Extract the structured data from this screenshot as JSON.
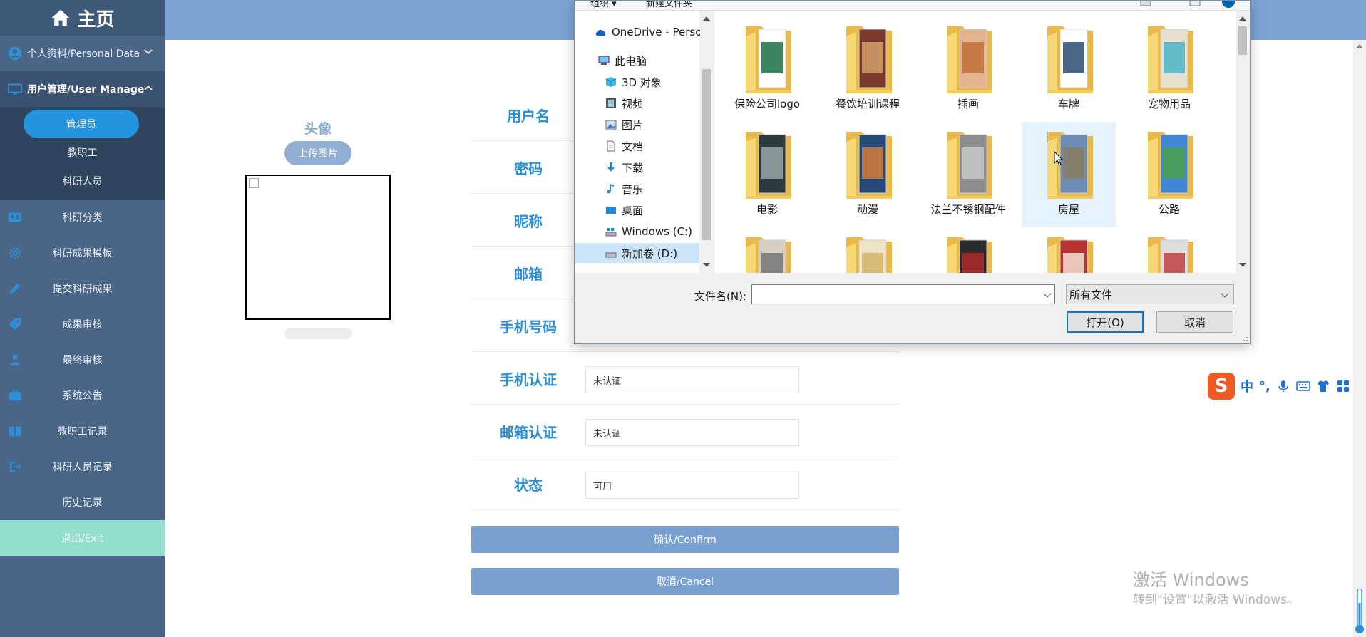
{
  "sidebar": {
    "home_label": "主页",
    "personal": "个人资料/Personal Data",
    "user_manage": "用户管理/User Manage",
    "sub_items": [
      "管理员",
      "教职工",
      "科研人员"
    ],
    "items": [
      "科研分类",
      "科研成果模板",
      "提交科研成果",
      "成果审核",
      "最终审核",
      "系统公告",
      "教职工记录",
      "科研人员记录",
      "历史记录"
    ],
    "exit": "退出/Exit"
  },
  "avatar": {
    "title": "头像",
    "upload": "上传图片"
  },
  "form": {
    "labels": [
      "用户名",
      "密码",
      "昵称",
      "邮箱",
      "手机号码",
      "手机认证",
      "邮箱认证",
      "状态"
    ],
    "values": [
      "",
      "",
      "",
      "",
      "",
      "未认证",
      "未认证",
      "可用"
    ],
    "confirm": "确认/Confirm",
    "cancel": "取消/Cancel"
  },
  "watermark": {
    "line1": "激活 Windows",
    "line2": "转到\"设置\"以激活 Windows。"
  },
  "ime": {
    "zh": "中",
    "punct": "°,"
  },
  "dialog": {
    "top_organize": "组织 ▾",
    "top_newfolder": "新建文件夹",
    "nav": [
      {
        "label": "OneDrive - Perso",
        "icon": "cloud-icon"
      },
      {
        "label": "此电脑",
        "icon": "computer-icon"
      },
      {
        "label": "3D 对象",
        "icon": "cube-icon"
      },
      {
        "label": "视频",
        "icon": "video-icon"
      },
      {
        "label": "图片",
        "icon": "picture-icon"
      },
      {
        "label": "文档",
        "icon": "document-icon"
      },
      {
        "label": "下载",
        "icon": "download-icon"
      },
      {
        "label": "音乐",
        "icon": "music-icon"
      },
      {
        "label": "桌面",
        "icon": "desktop-icon"
      },
      {
        "label": "Windows (C:)",
        "icon": "drive-icon"
      },
      {
        "label": "新加卷 (D:)",
        "icon": "drive-icon"
      }
    ],
    "folders": [
      "保险公司logo",
      "餐饮培训课程",
      "插画",
      "车牌",
      "宠物用品",
      "电影",
      "动漫",
      "法兰不锈钢配件",
      "房屋",
      "公路"
    ],
    "filename_label": "文件名(N):",
    "filename_value": "",
    "filetype": "所有文件",
    "open": "打开(O)",
    "cancel": "取消"
  },
  "colors": {
    "sidebar_bg": "#4a6585",
    "active_pill": "#2494de",
    "header_band": "#7ba4d3",
    "label_blue": "#2d8fd6",
    "button_blue": "#79a0cf",
    "exit_mint": "#93dfcc",
    "folder_yellow": "#f8d775"
  }
}
